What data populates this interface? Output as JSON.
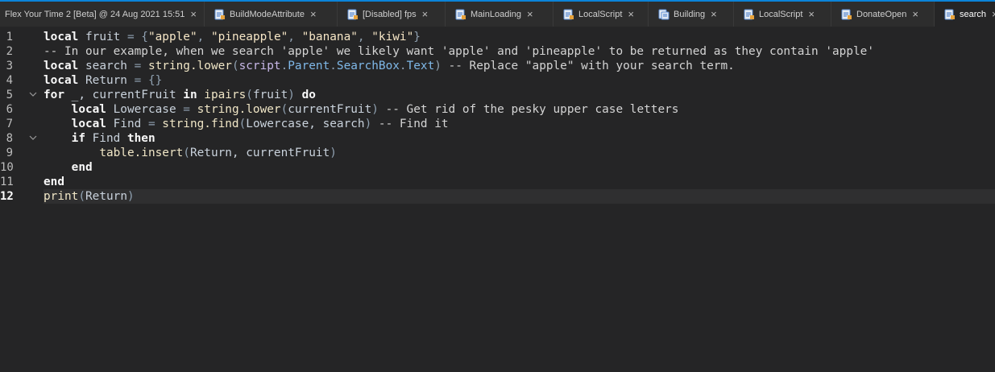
{
  "tabs": [
    {
      "label": "Flex Your Time 2 [Beta] @ 24 Aug 2021 15:51",
      "icon": "none",
      "active": false
    },
    {
      "label": "BuildModeAttribute",
      "icon": "script-icon",
      "active": false
    },
    {
      "label": "[Disabled] fps",
      "icon": "script-icon",
      "active": false
    },
    {
      "label": "MainLoading",
      "icon": "script-icon",
      "active": false
    },
    {
      "label": "LocalScript",
      "icon": "script-icon",
      "active": false
    },
    {
      "label": "Building",
      "icon": "module-script-icon",
      "active": false
    },
    {
      "label": "LocalScript",
      "icon": "script-icon",
      "active": false
    },
    {
      "label": "DonateOpen",
      "icon": "script-icon",
      "active": false
    },
    {
      "label": "search",
      "icon": "script-icon",
      "active": true
    }
  ],
  "close_glyph": "×",
  "editor": {
    "line_numbers": [
      "1",
      "2",
      "3",
      "4",
      "5",
      "6",
      "7",
      "8",
      "9",
      "10",
      "11",
      "12"
    ],
    "current_line": 12,
    "fold_lines": [
      5,
      8
    ],
    "lines": [
      [
        [
          "kw",
          "local"
        ],
        [
          "id",
          " fruit "
        ],
        [
          "pn",
          "= {"
        ],
        [
          "str",
          "\"apple\""
        ],
        [
          "pn",
          ", "
        ],
        [
          "str",
          "\"pineapple\""
        ],
        [
          "pn",
          ", "
        ],
        [
          "str",
          "\"banana\""
        ],
        [
          "pn",
          ", "
        ],
        [
          "str",
          "\"kiwi\""
        ],
        [
          "pn",
          "}"
        ]
      ],
      [
        [
          "cm",
          "-- In our example, when we search 'apple' we likely want 'apple' and 'pineapple' to be returned as they contain 'apple'"
        ]
      ],
      [
        [
          "kw",
          "local"
        ],
        [
          "id",
          " search "
        ],
        [
          "pn",
          "= "
        ],
        [
          "fn",
          "string.lower"
        ],
        [
          "pn",
          "("
        ],
        [
          "bi",
          "script"
        ],
        [
          "pn",
          "."
        ],
        [
          "prop",
          "Parent"
        ],
        [
          "pn",
          "."
        ],
        [
          "prop",
          "SearchBox"
        ],
        [
          "pn",
          "."
        ],
        [
          "prop",
          "Text"
        ],
        [
          "pn",
          ") "
        ],
        [
          "cm",
          "-- Replace \"apple\" with your search term."
        ]
      ],
      [
        [
          "kw",
          "local"
        ],
        [
          "id",
          " Return "
        ],
        [
          "pn",
          "= {}"
        ]
      ],
      [
        [
          "kw",
          "for"
        ],
        [
          "id",
          " _, currentFruit "
        ],
        [
          "kw",
          "in"
        ],
        [
          "fn",
          " ipairs"
        ],
        [
          "pn",
          "("
        ],
        [
          "id",
          "fruit"
        ],
        [
          "pn",
          ") "
        ],
        [
          "kw",
          "do"
        ]
      ],
      [
        [
          "id",
          "    "
        ],
        [
          "kw",
          "local"
        ],
        [
          "id",
          " Lowercase "
        ],
        [
          "pn",
          "= "
        ],
        [
          "fn",
          "string.lower"
        ],
        [
          "pn",
          "("
        ],
        [
          "id",
          "currentFruit"
        ],
        [
          "pn",
          ") "
        ],
        [
          "cm",
          "-- Get rid of the pesky upper case letters"
        ]
      ],
      [
        [
          "id",
          "    "
        ],
        [
          "kw",
          "local"
        ],
        [
          "id",
          " Find "
        ],
        [
          "pn",
          "= "
        ],
        [
          "fn",
          "string.find"
        ],
        [
          "pn",
          "("
        ],
        [
          "id",
          "Lowercase, search"
        ],
        [
          "pn",
          ") "
        ],
        [
          "cm",
          "-- Find it"
        ]
      ],
      [
        [
          "id",
          "    "
        ],
        [
          "kw",
          "if"
        ],
        [
          "id",
          " Find "
        ],
        [
          "kw",
          "then"
        ]
      ],
      [
        [
          "id",
          "        "
        ],
        [
          "fn",
          "table.insert"
        ],
        [
          "pn",
          "("
        ],
        [
          "id",
          "Return, currentFruit"
        ],
        [
          "pn",
          ")"
        ]
      ],
      [
        [
          "id",
          "    "
        ],
        [
          "kw",
          "end"
        ]
      ],
      [
        [
          "kw",
          "end"
        ]
      ],
      [
        [
          "fn",
          "print"
        ],
        [
          "pn",
          "("
        ],
        [
          "id",
          "Return"
        ],
        [
          "pn",
          ")"
        ]
      ]
    ]
  }
}
